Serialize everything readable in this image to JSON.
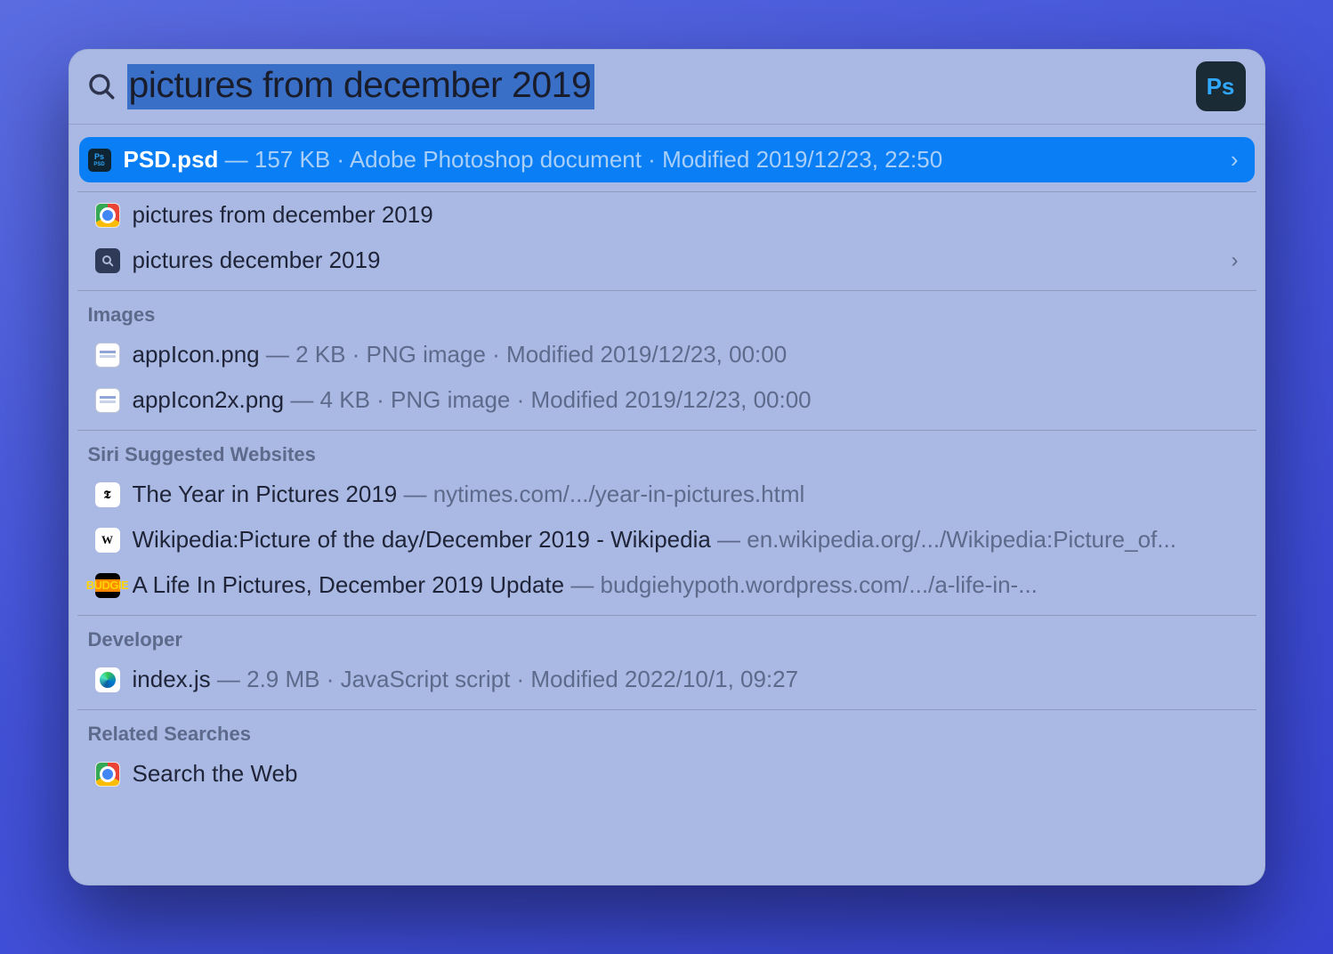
{
  "search": {
    "query": "pictures from december 2019",
    "app_badge": "Ps"
  },
  "top_hit": {
    "icon_top": "Ps",
    "icon_sub": "PSD",
    "title": "PSD.psd",
    "meta": " — 157 KB · Adobe Photoshop document · Modified 2019/12/23, 22:50"
  },
  "suggestions": [
    {
      "icon": "chrome",
      "label": "pictures from december 2019",
      "chevron": false
    },
    {
      "icon": "magnify",
      "label": "pictures december 2019",
      "chevron": true
    }
  ],
  "sections": [
    {
      "header": "Images",
      "items": [
        {
          "icon": "file",
          "title": "appIcon.png",
          "meta": " — 2 KB · PNG image · Modified 2019/12/23, 00:00"
        },
        {
          "icon": "file",
          "title": "appIcon2x.png",
          "meta": " — 4 KB · PNG image · Modified 2019/12/23, 00:00"
        }
      ]
    },
    {
      "header": "Siri Suggested Websites",
      "items": [
        {
          "icon": "nyt",
          "title": "The Year in Pictures 2019",
          "meta": " — nytimes.com/.../year-in-pictures.html"
        },
        {
          "icon": "wiki",
          "title": "Wikipedia:Picture of the day/December 2019 - Wikipedia",
          "meta": " — en.wikipedia.org/.../Wikipedia:Picture_of..."
        },
        {
          "icon": "budgie",
          "title": "A Life In Pictures, December 2019 Update",
          "meta": " — budgiehypoth.wordpress.com/.../a-life-in-..."
        }
      ]
    },
    {
      "header": "Developer",
      "items": [
        {
          "icon": "edge",
          "title": "index.js",
          "meta": " — 2.9 MB · JavaScript script · Modified 2022/10/1, 09:27"
        }
      ]
    },
    {
      "header": "Related Searches",
      "items": [
        {
          "icon": "chrome",
          "title": "Search the Web",
          "meta": ""
        }
      ]
    }
  ]
}
